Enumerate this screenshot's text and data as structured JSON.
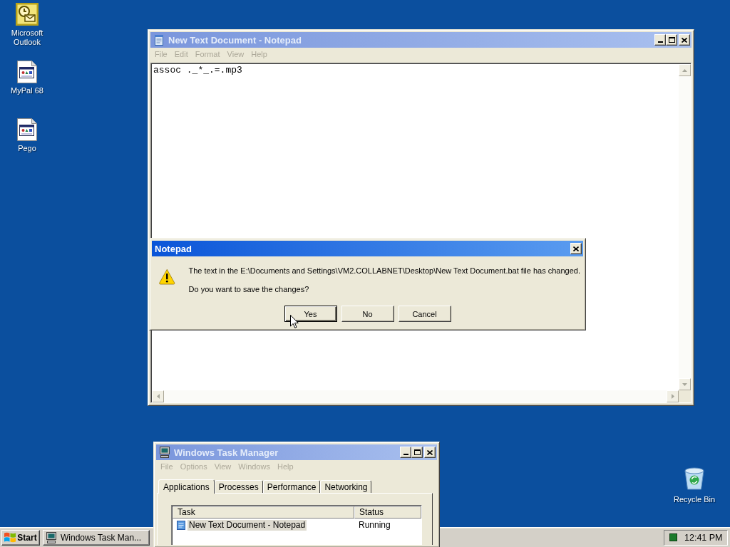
{
  "desktop_icons": [
    {
      "label": "Microsoft Outlook",
      "kind": "outlook"
    },
    {
      "label": "MyPal 68",
      "kind": "program"
    },
    {
      "label": "Pego",
      "kind": "program"
    }
  ],
  "recycle_bin": {
    "label": "Recycle Bin"
  },
  "notepad": {
    "title": "New Text Document - Notepad",
    "active": false,
    "menu": [
      "File",
      "Edit",
      "Format",
      "View",
      "Help"
    ],
    "text": "assoc ._*_.=.mp3"
  },
  "dialog": {
    "title": "Notepad",
    "active": true,
    "message": "The text in the E:\\Documents and Settings\\VM2.COLLABNET\\Desktop\\New Text Document.bat file has changed.",
    "question": "Do you want to save the changes?",
    "buttons": [
      {
        "label": "Yes",
        "focused": true
      },
      {
        "label": "No",
        "focused": false
      },
      {
        "label": "Cancel",
        "focused": false
      }
    ]
  },
  "task_manager": {
    "title": "Windows Task Manager",
    "active": false,
    "menu": [
      "File",
      "Options",
      "View",
      "Windows",
      "Help"
    ],
    "tabs": [
      {
        "label": "Applications",
        "selected": true
      },
      {
        "label": "Processes",
        "selected": false
      },
      {
        "label": "Performance",
        "selected": false
      },
      {
        "label": "Networking",
        "selected": false
      }
    ],
    "columns": [
      "Task",
      "Status"
    ],
    "rows": [
      {
        "task": "New Text Document - Notepad",
        "status": "Running",
        "selected": true
      }
    ]
  },
  "taskbar": {
    "start": "Start",
    "tasks": [
      {
        "label": "Windows Task Man...",
        "pressed": false
      }
    ],
    "clock": "12:41 PM"
  }
}
